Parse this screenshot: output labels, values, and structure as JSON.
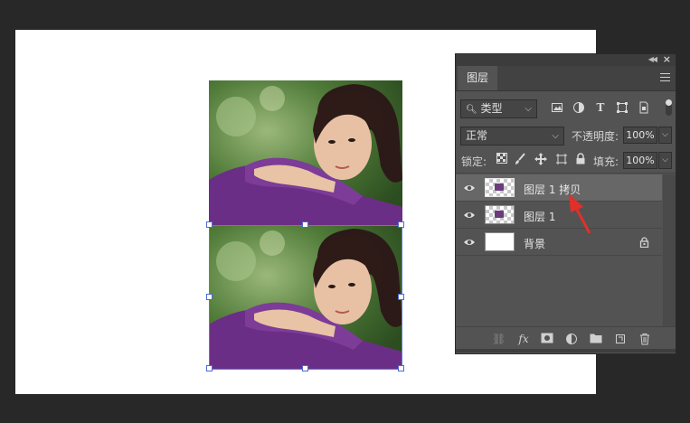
{
  "panel": {
    "tab_label": "图层",
    "filter": {
      "kind_label": "类型"
    },
    "blend_mode": "正常",
    "opacity_label": "不透明度:",
    "opacity_value": "100%",
    "lock_label": "锁定:",
    "fill_label": "填充:",
    "fill_value": "100%",
    "layers": [
      {
        "name": "图层 1 拷贝",
        "selected": true,
        "visible": true
      },
      {
        "name": "图层 1",
        "selected": false,
        "visible": true
      },
      {
        "name": "背景",
        "selected": false,
        "visible": true,
        "locked": true
      }
    ],
    "footer_icons": [
      "link-icon",
      "fx-icon",
      "mask-icon",
      "adjustment-icon",
      "folder-icon",
      "new-layer-icon",
      "trash-icon"
    ],
    "fx_label": "fx"
  },
  "colors": {
    "workspace_bg": "#282828",
    "panel_bg": "#535353",
    "selection_border": "#5a7ad8",
    "arrow_red": "#e0302a"
  }
}
